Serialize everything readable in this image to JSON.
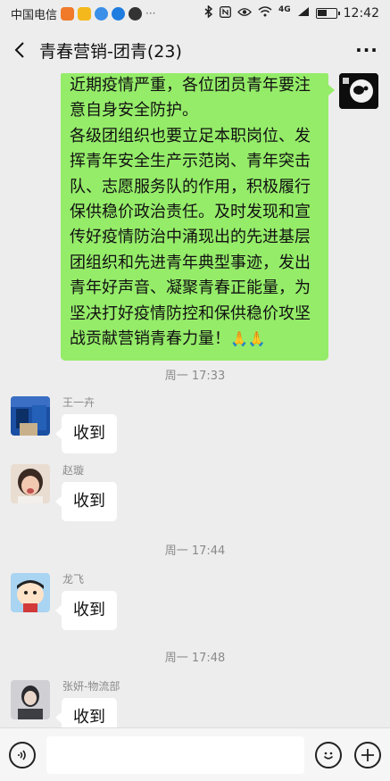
{
  "status_bar": {
    "carrier": "中国电信",
    "time": "12:42",
    "signal_label": "4G",
    "battery_level": 0.55
  },
  "header": {
    "title": "青春营销-团青(23)",
    "more_label": "···"
  },
  "messages": {
    "self_text": "近期疫情严重，各位团员青年要注意自身安全防护。\n各级团组织也要立足本职岗位、发挥青年安全生产示范岗、青年突击队、志愿服务队的作用，积极履行保供稳价政治责任。及时发现和宣传好疫情防治中涌现出的先进基层团组织和先进青年典型事迹，发出青年好声音、凝聚青春正能量，为坚决打好疫情防控和保供稳价攻坚战贡献营销青春力量！",
    "self_emoji": "🙏🙏",
    "time_1": "周一 17:33",
    "msg_1_sender": "王一卉",
    "msg_1_text": "收到",
    "msg_2_sender": "赵璇",
    "msg_2_text": "收到",
    "time_2": "周一 17:44",
    "msg_3_sender": "龙飞",
    "msg_3_text": "收到",
    "time_3": "周一 17:48",
    "msg_4_sender": "张妍-物流部",
    "msg_4_text": "收到"
  },
  "colors": {
    "self_bubble": "#95ec69",
    "background": "#ededed"
  }
}
